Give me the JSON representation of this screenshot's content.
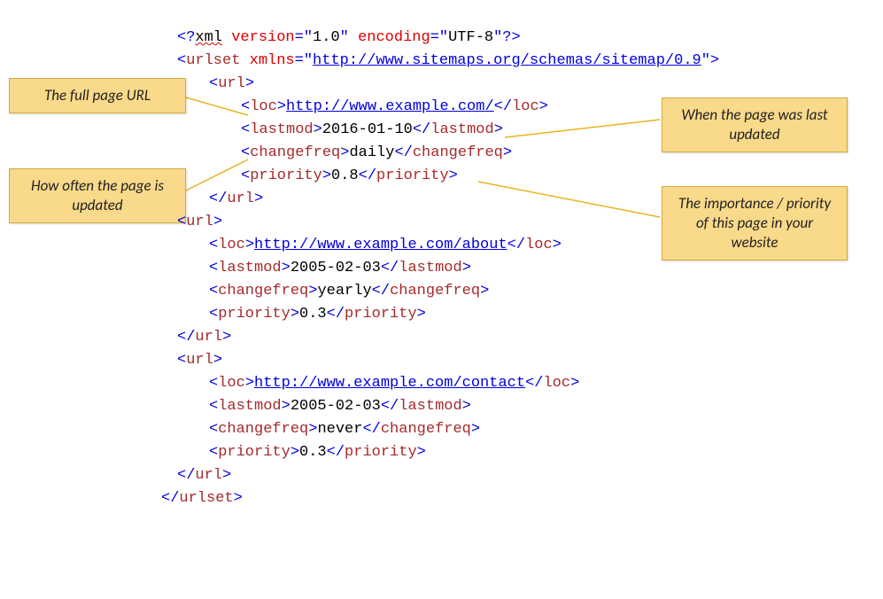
{
  "xml_decl": {
    "version": "1.0",
    "encoding": "UTF-8"
  },
  "root": {
    "name": "urlset",
    "xmlns": "http://www.sitemaps.org/schemas/sitemap/0.9"
  },
  "urls": [
    {
      "loc": "http://www.example.com/",
      "lastmod": "2016-01-10",
      "changefreq": "daily",
      "priority": "0.8"
    },
    {
      "loc": "http://www.example.com/about",
      "lastmod": "2005-02-03",
      "changefreq": "yearly",
      "priority": "0.3"
    },
    {
      "loc": "http://www.example.com/contact",
      "lastmod": "2005-02-03",
      "changefreq": "never",
      "priority": "0.3"
    }
  ],
  "callouts": {
    "url": "The full page URL",
    "freq": "How often the page is updated",
    "lastmod": "When the page was last updated",
    "priority": "The importance / priority of this page in your website"
  }
}
